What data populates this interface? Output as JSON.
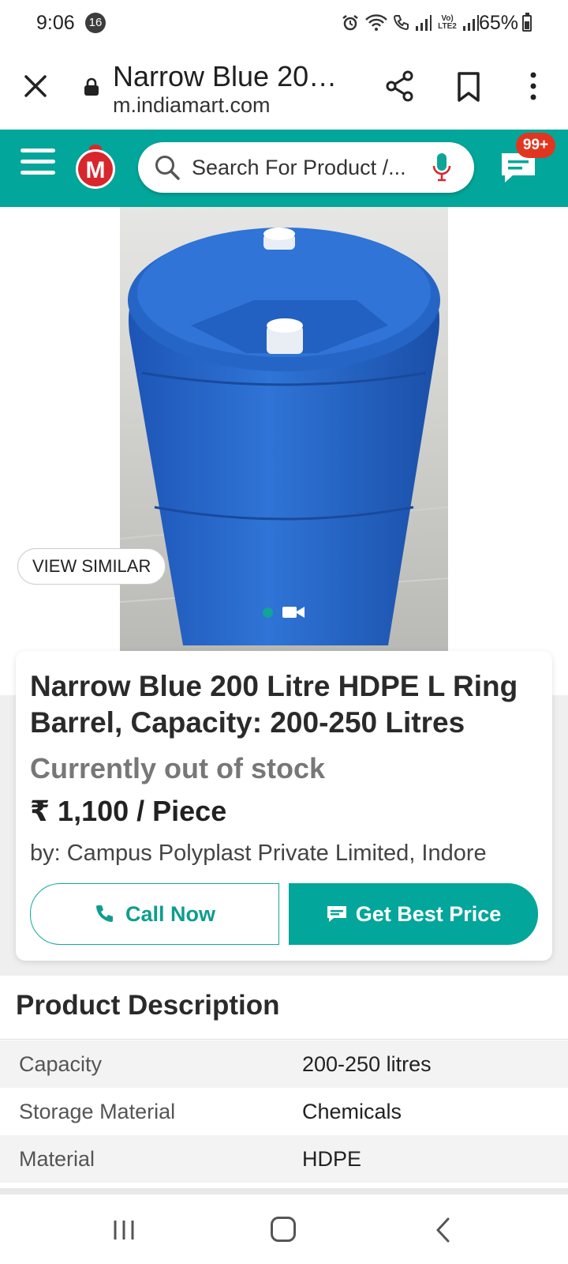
{
  "status_bar": {
    "time": "9:06",
    "notification_count": "16",
    "battery": "65%",
    "network_label": "Vo) LTE2"
  },
  "browser": {
    "title": "Narrow Blue 20…",
    "url": "m.indiamart.com"
  },
  "header": {
    "search_placeholder": "Search For Product /...",
    "chat_badge": "99+",
    "logo_letter": "M",
    "colors": {
      "teal": "#03a69a",
      "badge_red": "#e2351f"
    }
  },
  "image_area": {
    "view_similar_label": "VIEW SIMILAR",
    "image_alt": "Blue HDPE L ring barrel"
  },
  "product": {
    "title": "Narrow Blue 200 Litre HDPE L Ring Barrel, Capacity: 200-250 Litres",
    "stock_status": "Currently out of stock",
    "price": "₹ 1,100 / Piece",
    "seller": "by: Campus Polyplast Private Limited, Indore",
    "call_now_label": "Call Now",
    "get_best_price_label": "Get Best Price"
  },
  "description": {
    "heading": "Product Description",
    "rows": [
      {
        "key": "Capacity",
        "value": "200-250 litres"
      },
      {
        "key": "Storage Material",
        "value": "Chemicals"
      },
      {
        "key": "Material",
        "value": "HDPE"
      }
    ]
  }
}
